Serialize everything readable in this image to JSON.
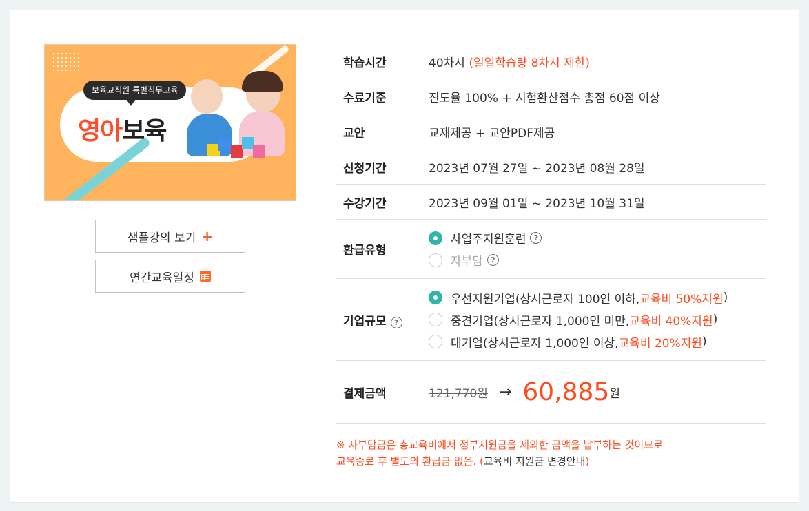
{
  "banner": {
    "tag": "보육교직원 특별직무교육",
    "title_accent": "영아",
    "title_rest": "보육"
  },
  "buttons": {
    "sample_label": "샘플강의 보기",
    "sample_icon": "plus-icon",
    "schedule_label": "연간교육일정",
    "schedule_icon": "calendar-icon"
  },
  "info": {
    "study_time": {
      "label": "학습시간",
      "value": "40차시",
      "note": "(일일학습량 8차시 제한)"
    },
    "completion": {
      "label": "수료기준",
      "value": "진도율 100% + 시험환산점수 총점 60점 이상"
    },
    "material": {
      "label": "교안",
      "value": "교재제공 + 교안PDF제공"
    },
    "apply_period": {
      "label": "신청기간",
      "value": "2023년 07월 27일 ~ 2023년 08월 28일"
    },
    "course_period": {
      "label": "수강기간",
      "value": "2023년 09월 01일 ~ 2023년 10월 31일"
    },
    "refund_type": {
      "label": "환급유형",
      "options": [
        {
          "label": "사업주지원훈련",
          "selected": true,
          "disabled": false
        },
        {
          "label": "자부담",
          "selected": false,
          "disabled": true
        }
      ]
    },
    "company_size": {
      "label": "기업규모",
      "options": [
        {
          "label": "우선지원기업(상시근로자 100인 이하, ",
          "highlight": "교육비 50%지원",
          "suffix": ")",
          "selected": true
        },
        {
          "label": "중견기업(상시근로자 1,000인 미만, ",
          "highlight": "교육비 40%지원",
          "suffix": ")",
          "selected": false
        },
        {
          "label": "대기업(상시근로자 1,000인 이상, ",
          "highlight": "교육비 20%지원",
          "suffix": ")",
          "selected": false
        }
      ]
    },
    "payment": {
      "label": "결제금액",
      "original": "121,770원",
      "final": "60,885",
      "unit": "원"
    }
  },
  "note": {
    "line1": "※ 자부담금은 총교육비에서 정부지원금을 제외한 금액을 납부하는 것이므로",
    "line2_prefix": "교육종료 후 별도의 환급금 없음. (",
    "link": "교육비 지원금 변경안내",
    "line2_suffix": ")"
  },
  "colors": {
    "accent": "#ff4b1f",
    "teal": "#2fb6a8",
    "banner_bg": "#ffb35c"
  }
}
